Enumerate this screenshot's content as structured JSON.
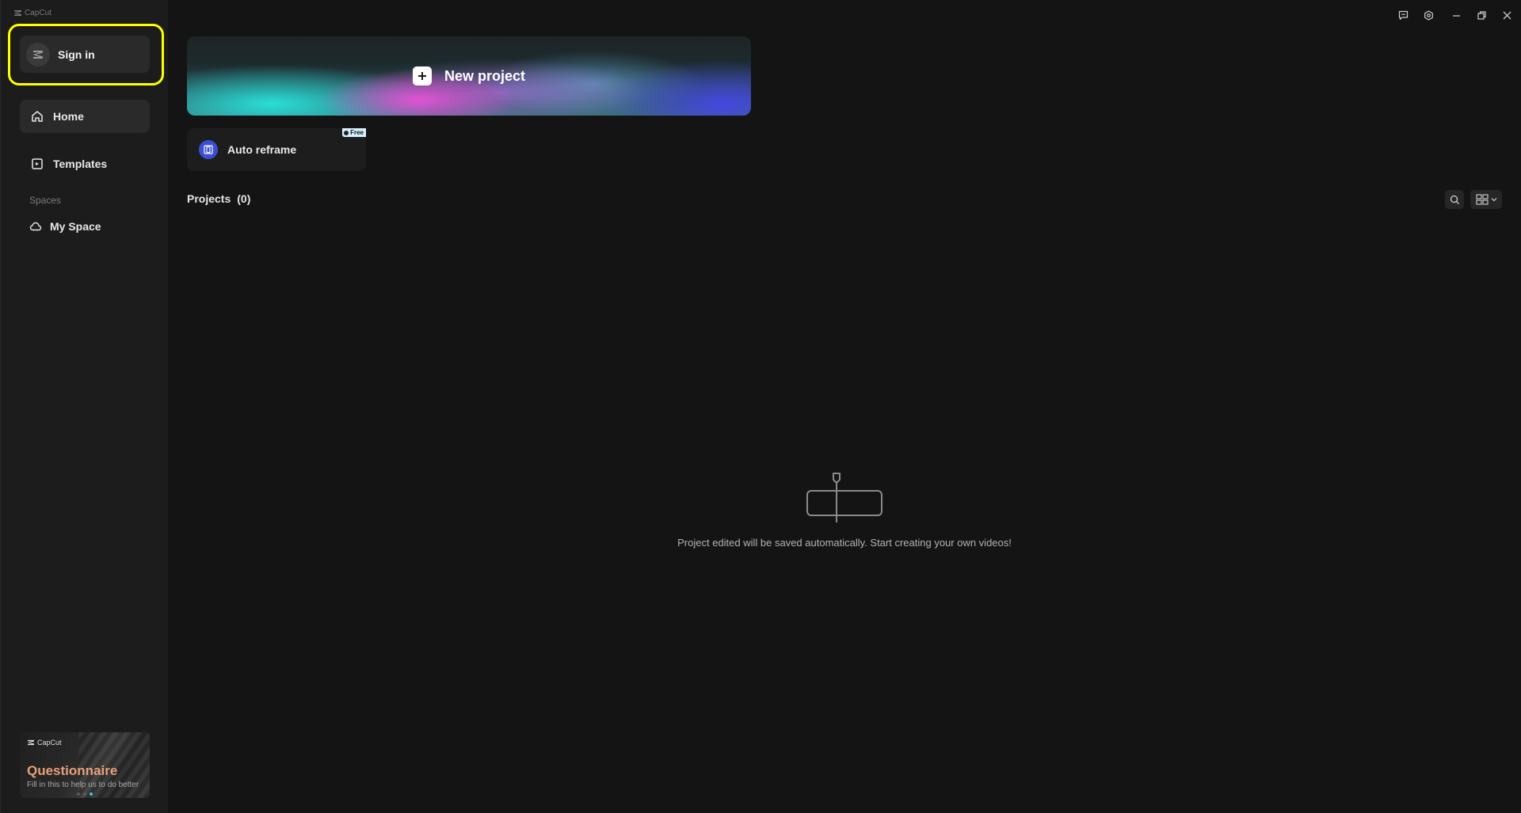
{
  "app": {
    "name": "CapCut"
  },
  "sidebar": {
    "sign_in_label": "Sign in",
    "nav": {
      "home": "Home",
      "templates": "Templates"
    },
    "spaces_label": "Spaces",
    "my_space": "My Space",
    "questionnaire": {
      "brand": "CapCut",
      "title": "Questionnaire",
      "subtitle": "Fill in this to help us to do better"
    }
  },
  "main": {
    "new_project_label": "New project",
    "auto_reframe": {
      "label": "Auto reframe",
      "badge": "Free"
    },
    "projects": {
      "title": "Projects",
      "count": "(0)",
      "empty_message": "Project edited will be saved automatically. Start creating your own videos!"
    }
  },
  "colors": {
    "background": "#141414",
    "sidebar": "#1c1c1c",
    "highlight": "#ffff00",
    "questionnaire_title": "#e8a07a",
    "reframe_icon": "#3b4fd6"
  },
  "icons": [
    "feedback-icon",
    "settings-icon",
    "minimize-icon",
    "restore-icon",
    "close-icon",
    "home-icon",
    "templates-icon",
    "cloud-icon",
    "search-icon",
    "grid-view-icon",
    "plus-icon"
  ]
}
